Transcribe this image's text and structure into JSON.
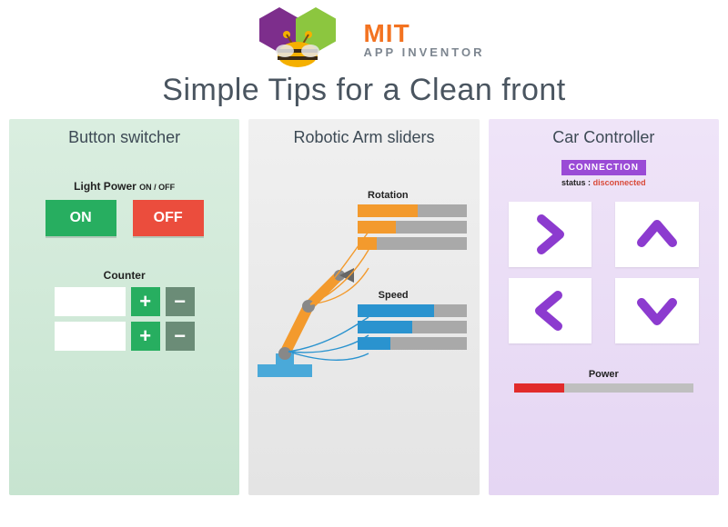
{
  "header": {
    "brand_top": "MIT",
    "brand_sub": "APP INVENTOR",
    "tagline": "Simple Tips for a Clean front"
  },
  "panel1": {
    "title": "Button switcher",
    "light_label": "Light Power",
    "light_label_suffix": "ON / OFF",
    "on_label": "ON",
    "off_label": "OFF",
    "counter_label": "Counter",
    "plus": "+",
    "minus": "−",
    "rows": [
      {
        "value": ""
      },
      {
        "value": ""
      }
    ]
  },
  "panel2": {
    "title": "Robotic Arm sliders",
    "rotation_label": "Rotation",
    "speed_label": "Speed",
    "rotation_values": [
      55,
      35,
      18
    ],
    "speed_values": [
      70,
      50,
      30
    ]
  },
  "panel3": {
    "title": "Car Controller",
    "connection_badge": "CONNECTION",
    "status_key": "status :",
    "status_value": "disconnected",
    "power_label": "Power",
    "power_percent": 28
  },
  "colors": {
    "purple": "#8c3bcf",
    "green_hex": "#8cc63f",
    "orange": "#f37321"
  }
}
